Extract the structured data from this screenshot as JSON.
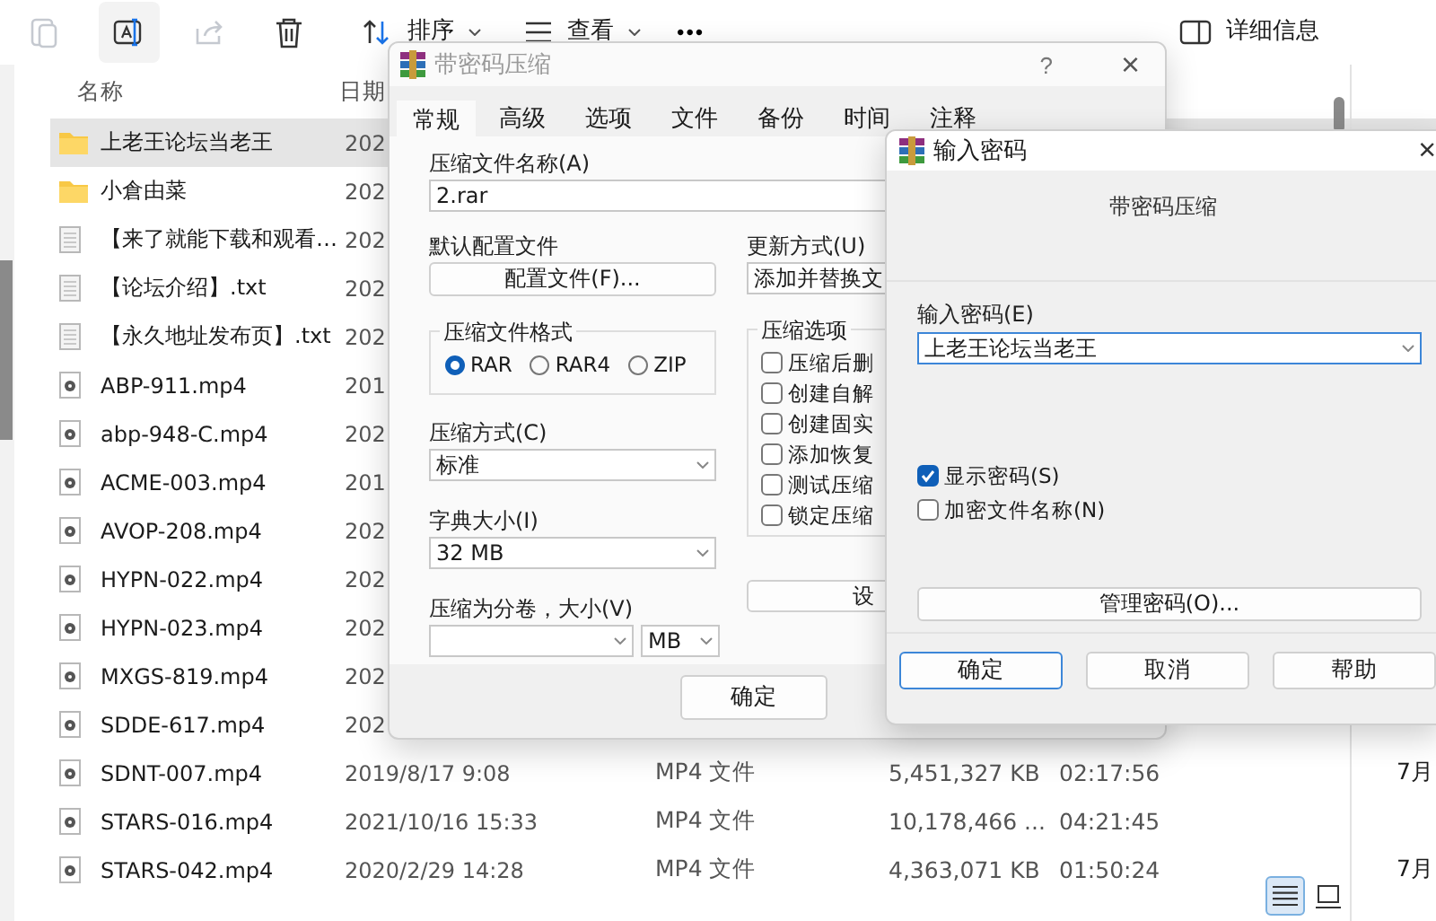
{
  "toolbar": {
    "sort_label": "排序",
    "view_label": "查看",
    "more": "•••",
    "details_label": "详细信息"
  },
  "file_list": {
    "columns": [
      "名称",
      "日期"
    ],
    "rows": [
      {
        "kind": "folder",
        "name": "上老王论坛当老王",
        "date": "202",
        "selected": true
      },
      {
        "kind": "folder",
        "name": "小倉由菜",
        "date": "202",
        "selected": false
      },
      {
        "kind": "text",
        "name": "【来了就能下载和观看…",
        "date": "202",
        "selected": false
      },
      {
        "kind": "text",
        "name": "【论坛介绍】.txt",
        "date": "202",
        "selected": false
      },
      {
        "kind": "text",
        "name": "【永久地址发布页】.txt",
        "date": "202",
        "selected": false
      },
      {
        "kind": "video",
        "name": "ABP-911.mp4",
        "date": "201",
        "selected": false
      },
      {
        "kind": "video",
        "name": "abp-948-C.mp4",
        "date": "202",
        "selected": false
      },
      {
        "kind": "video",
        "name": "ACME-003.mp4",
        "date": "201",
        "selected": false
      },
      {
        "kind": "video",
        "name": "AVOP-208.mp4",
        "date": "202",
        "selected": false
      },
      {
        "kind": "video",
        "name": "HYPN-022.mp4",
        "date": "202",
        "selected": false
      },
      {
        "kind": "video",
        "name": "HYPN-023.mp4",
        "date": "202",
        "selected": false
      },
      {
        "kind": "video",
        "name": "MXGS-819.mp4",
        "date": "202",
        "selected": false
      },
      {
        "kind": "video",
        "name": "SDDE-617.mp4",
        "date": "202",
        "selected": false
      },
      {
        "kind": "video",
        "name": "SDNT-007.mp4",
        "date": "2019/8/17 9:08",
        "type": "MP4 文件",
        "size": "5,451,327 KB",
        "duration": "02:17:56",
        "column_6": "7月",
        "selected": false
      },
      {
        "kind": "video",
        "name": "STARS-016.mp4",
        "date": "2021/10/16 15:33",
        "type": "MP4 文件",
        "size": "10,178,466 ...",
        "duration": "04:21:45",
        "selected": false
      },
      {
        "kind": "video",
        "name": "STARS-042.mp4",
        "date": "2020/2/29 14:28",
        "type": "MP4 文件",
        "size": "4,363,071 KB",
        "duration": "01:50:24",
        "column_6": "7月",
        "selected": false
      }
    ]
  },
  "view_buttons": [
    {
      "kind": "details",
      "selected": true
    },
    {
      "kind": "tiles",
      "selected": false
    }
  ],
  "archive_dialog": {
    "title": "带密码压缩",
    "help": "?",
    "close": "×",
    "tabs": [
      {
        "label": "常规",
        "selected": true
      },
      {
        "label": "高级",
        "selected": false
      },
      {
        "label": "选项",
        "selected": false
      },
      {
        "label": "文件",
        "selected": false
      },
      {
        "label": "备份",
        "selected": false
      },
      {
        "label": "时间",
        "selected": false
      },
      {
        "label": "注释",
        "selected": false
      }
    ],
    "archive_name_label": "压缩文件名称(A)",
    "archive_name": "2.rar",
    "profile_label": "默认配置文件",
    "profile_button": "配置文件(F)...",
    "update_label": "更新方式(U)",
    "update_value": "添加并替换文",
    "format_label": "压缩文件格式",
    "formats": [
      {
        "label": "RAR",
        "selected": true
      },
      {
        "label": "RAR4",
        "selected": false
      },
      {
        "label": "ZIP",
        "selected": false
      }
    ],
    "method_label": "压缩方式(C)",
    "method": "标准",
    "dict_label": "字典大小(I)",
    "dict": "32 MB",
    "split_label": "压缩为分卷，大小(V)",
    "split_unit": "MB",
    "options_label": "压缩选项",
    "options": [
      {
        "label": "压缩后删",
        "checked": false
      },
      {
        "label": "创建自解",
        "checked": false
      },
      {
        "label": "创建固实",
        "checked": false
      },
      {
        "label": "添加恢复",
        "checked": false
      },
      {
        "label": "测试压缩",
        "checked": false
      },
      {
        "label": "锁定压缩",
        "checked": false
      }
    ],
    "set_button": "设",
    "ok": "确定"
  },
  "password_dialog": {
    "title": "输入密码",
    "close": "×",
    "subtitle": "带密码压缩",
    "password_label": "输入密码(E)",
    "password": "上老王论坛当老王",
    "checks": [
      {
        "label": "显示密码(S)",
        "checked": true
      },
      {
        "label": "加密文件名称(N)",
        "checked": false
      }
    ],
    "manage_button": "管理密码(O)...",
    "buttons": [
      {
        "label": "确定",
        "default": true
      },
      {
        "label": "取消",
        "default": false
      },
      {
        "label": "帮助",
        "default": false
      }
    ]
  }
}
